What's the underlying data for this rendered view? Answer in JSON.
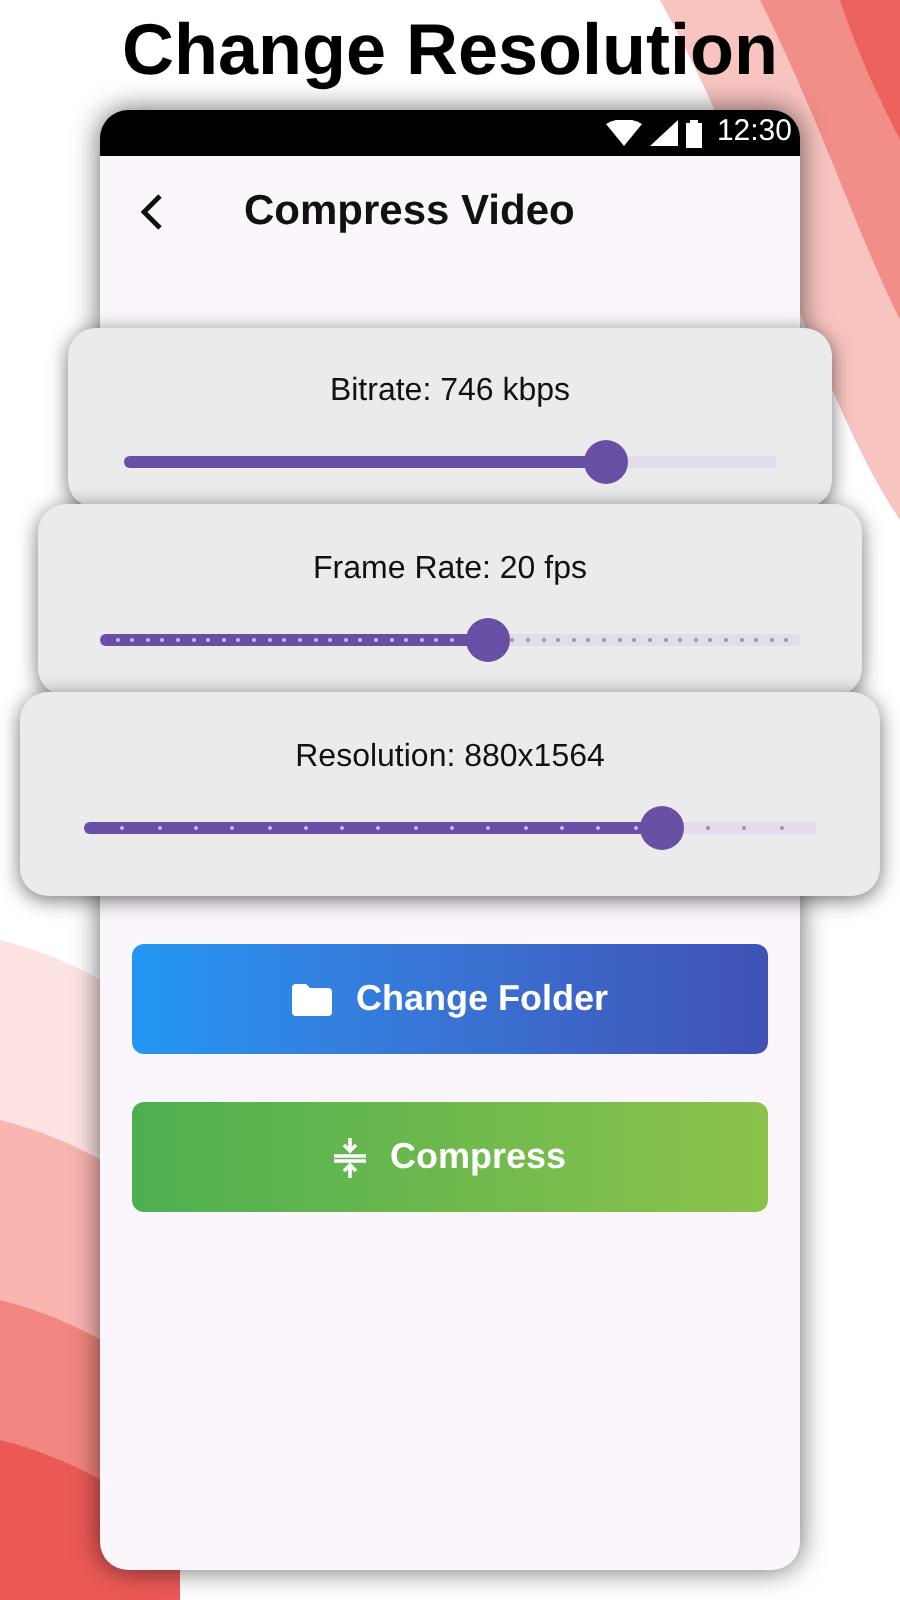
{
  "headline": "Change Resolution",
  "status_bar": {
    "time": "12:30"
  },
  "app_bar": {
    "title": "Compress Video"
  },
  "sliders": [
    {
      "label": "Bitrate: 746 kbps",
      "kind": "continuous",
      "level": 0.74
    },
    {
      "label": "Frame Rate: 20 fps",
      "kind": "fine-steps",
      "level": 0.555
    },
    {
      "label": "Resolution: 880x1564",
      "kind": "steps",
      "level": 0.79
    }
  ],
  "buttons": [
    {
      "label": "Change Folder",
      "kind": "folder"
    },
    {
      "label": "Compress",
      "kind": "compress"
    }
  ]
}
